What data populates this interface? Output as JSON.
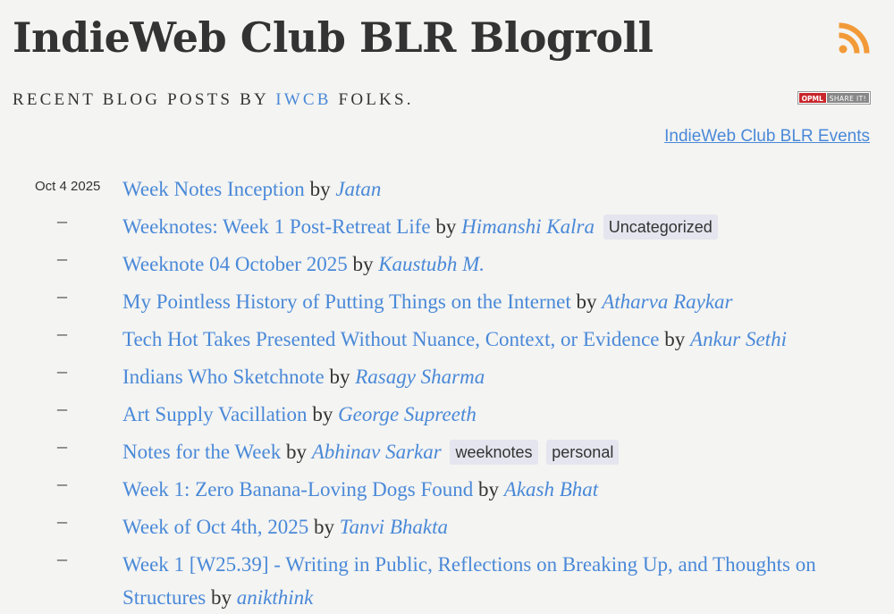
{
  "header": {
    "title": "IndieWeb Club BLR Blogroll",
    "subtitle_pre": "RECENT BLOG POSTS BY",
    "subtitle_link": "IWCB",
    "subtitle_post": "FOLKS.",
    "opml_label": "OPML",
    "share_label": "SHARE IT!",
    "events_link": "IndieWeb Club BLR Events",
    "rss_color": "#f29a38"
  },
  "posts": [
    {
      "date": "Oct 4 2025",
      "marker": "",
      "title": "Week Notes Inception",
      "by": "by",
      "author": "Jatan",
      "tags": []
    },
    {
      "date": "",
      "marker": "–",
      "title": "Weeknotes: Week 1 Post-Retreat Life",
      "by": "by",
      "author": "Himanshi Kalra",
      "tags": [
        "Uncategorized"
      ]
    },
    {
      "date": "",
      "marker": "–",
      "title": "Weeknote 04 October 2025",
      "by": "by",
      "author": "Kaustubh M.",
      "tags": []
    },
    {
      "date": "",
      "marker": "–",
      "title": "My Pointless History of Putting Things on the Internet",
      "by": "by",
      "author": "Atharva Raykar",
      "tags": []
    },
    {
      "date": "",
      "marker": "–",
      "title": "Tech Hot Takes Presented Without Nuance, Context, or Evidence",
      "by": "by",
      "author": "Ankur Sethi",
      "tags": []
    },
    {
      "date": "",
      "marker": "–",
      "title": "Indians Who Sketchnote",
      "by": "by",
      "author": "Rasagy Sharma",
      "tags": []
    },
    {
      "date": "",
      "marker": "–",
      "title": "Art Supply Vacillation",
      "by": "by",
      "author": "George Supreeth",
      "tags": []
    },
    {
      "date": "",
      "marker": "–",
      "title": "Notes for the Week",
      "by": "by",
      "author": "Abhinav Sarkar",
      "tags": [
        "weeknotes",
        "personal"
      ]
    },
    {
      "date": "",
      "marker": "–",
      "title": "Week 1: Zero Banana-Loving Dogs Found",
      "by": "by",
      "author": "Akash Bhat",
      "tags": []
    },
    {
      "date": "",
      "marker": "–",
      "title": "Week of Oct 4th, 2025",
      "by": "by",
      "author": "Tanvi Bhakta",
      "tags": []
    },
    {
      "date": "",
      "marker": "–",
      "title": "Week 1 [W25.39] - Writing in Public, Reflections on Breaking Up, and Thoughts on Structures",
      "by": "by",
      "author": "anikthink",
      "tags": []
    }
  ]
}
